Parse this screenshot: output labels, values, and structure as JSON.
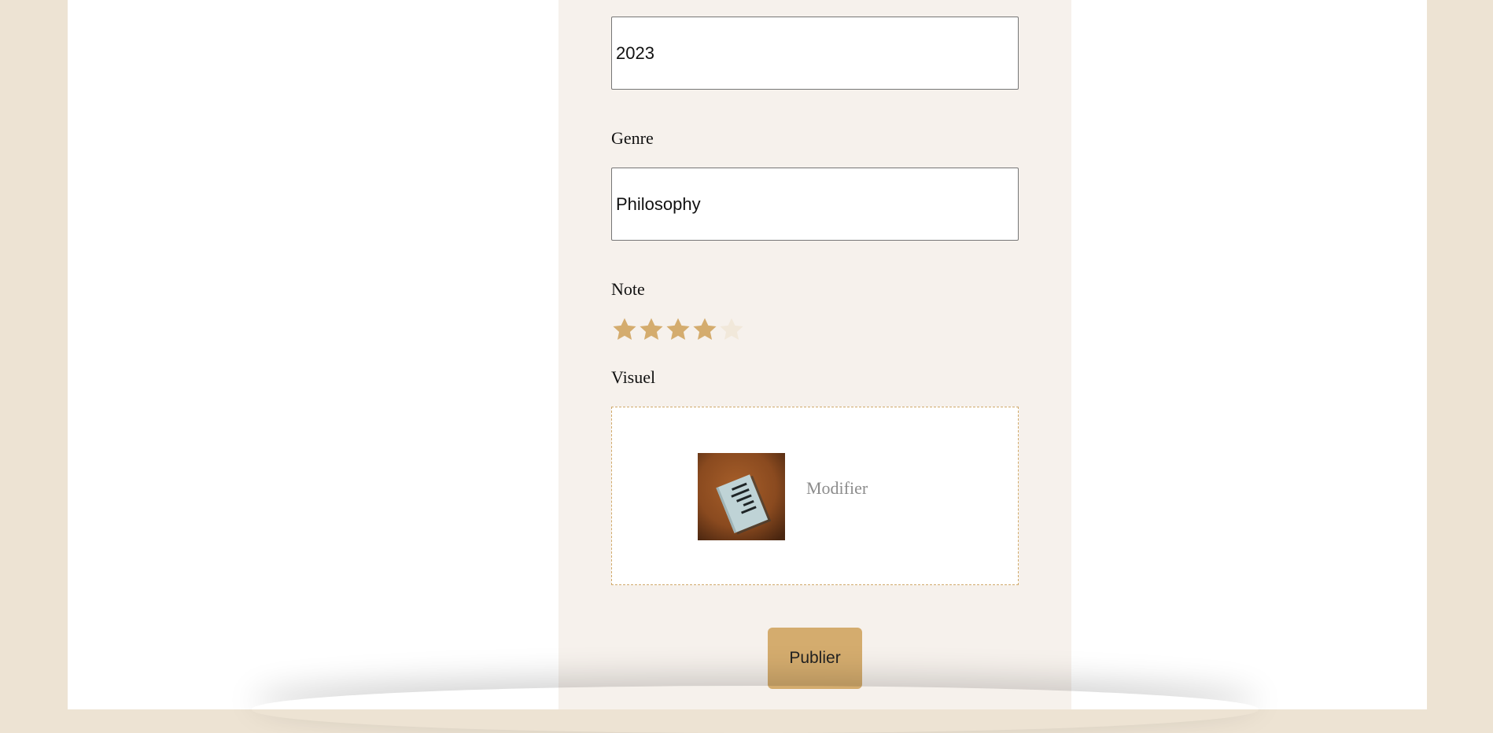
{
  "form": {
    "year": {
      "value": "2023"
    },
    "genre": {
      "label": "Genre",
      "value": "Philosophy"
    },
    "note": {
      "label": "Note",
      "rating": 4,
      "max": 5
    },
    "visual": {
      "label": "Visuel",
      "modify_label": "Modifier"
    },
    "publish_label": "Publier"
  },
  "colors": {
    "star_filled": "#d4ac6e",
    "star_empty": "#f1e8da",
    "accent": "#d4ac6e"
  }
}
